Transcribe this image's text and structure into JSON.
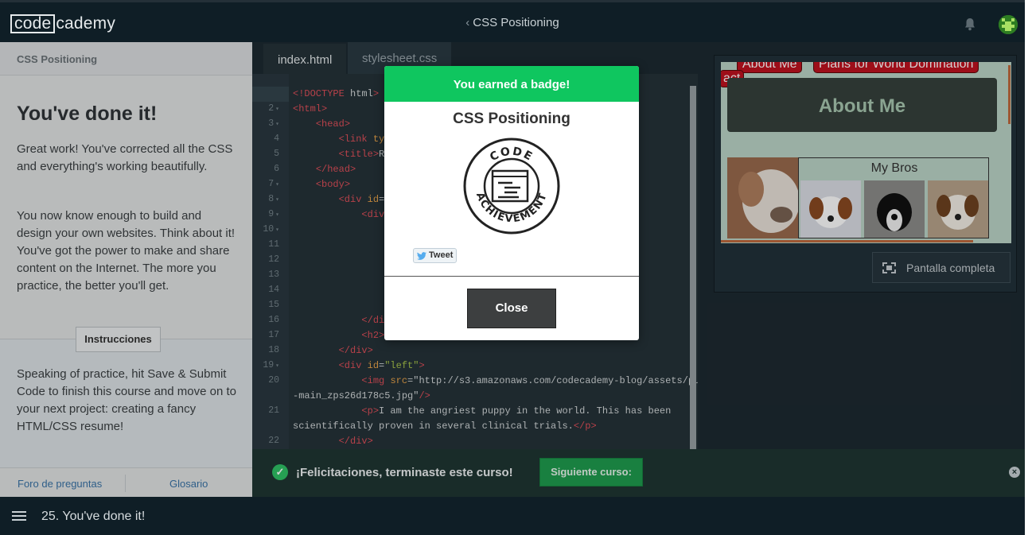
{
  "header": {
    "logo_box": "code",
    "logo_rest": "cademy",
    "course_title": "CSS Positioning",
    "back_chevron": "‹"
  },
  "lesson": {
    "section_title": "CSS Positioning",
    "heading": "You've done it!",
    "paragraphs": [
      "Great work! You've corrected all the CSS and everything's working beautifully.",
      "You now know enough to build and design your own websites. Think about it! You've got the power to make and share content on the Internet. The more you practice, the better you'll get."
    ],
    "instructions_label": "Instrucciones",
    "instructions_text": "Speaking of practice, hit Save & Submit Code to finish this course and move on to your next project: creating a fancy HTML/CSS resume!",
    "footer_links": [
      "Foro de preguntas",
      "Glosario"
    ]
  },
  "bottom_bar": {
    "lesson_label": "25. You've done it!"
  },
  "editor": {
    "tabs": [
      "index.html",
      "stylesheet.css"
    ],
    "active_tab": "index.html",
    "line_numbers": [
      "1",
      "2",
      "3",
      "4",
      "5",
      "6",
      "7",
      "8",
      "9",
      "10",
      "11",
      "12",
      "13",
      "14",
      "15",
      "16",
      "17",
      "18",
      "19",
      "20",
      "",
      "21",
      "",
      "22"
    ],
    "lines": [
      "<!DOCTYPE html>",
      "<html>",
      "    <head>",
      "        <link typ                                 t.css\"/>",
      "        <title>Re",
      "    </head>",
      "    <body>",
      "        <div id=\"",
      "            <div",
      "                <",
      "",
      "",
      "",
      "",
      "                <",
      "            </div",
      "            <h2>",
      "        </div>",
      "        <div id=\"left\">",
      "            <img src=\"http://s3.amazonaws.com/codecademy-blog/assets/puppy",
      "-main_zps26d178c5.jpg\"/>",
      "            <p>I am the angriest puppy in the world. This has been",
      "scientifically proven in several clinical trials.</p>",
      "        </div>"
    ]
  },
  "preview": {
    "nav_items": [
      "About Me",
      "Plans for World Domination",
      "act"
    ],
    "about_heading": "About Me",
    "bros_heading": "My Bros",
    "fullscreen_label": "Pantalla completa"
  },
  "completion": {
    "message": "¡Felicitaciones, terminaste este curso!",
    "next_button": "Siguiente curso:"
  },
  "modal": {
    "header": "You earned a badge!",
    "badge_title": "CSS Positioning",
    "badge_top_text": "CODE",
    "badge_bottom_text": "ACHIEVEMENT",
    "tweet_label": "Tweet",
    "close_label": "Close"
  },
  "colors": {
    "badge_green": "#0fc65f",
    "next_green": "#1f9d4f",
    "nav_red": "#c0121f",
    "topbar": "#0f1e26"
  },
  "icons": [
    "bell-icon",
    "avatar",
    "menu-icon",
    "check-icon",
    "close-x-icon",
    "fullscreen-icon",
    "twitter-bird-icon",
    "badge-emblem"
  ]
}
